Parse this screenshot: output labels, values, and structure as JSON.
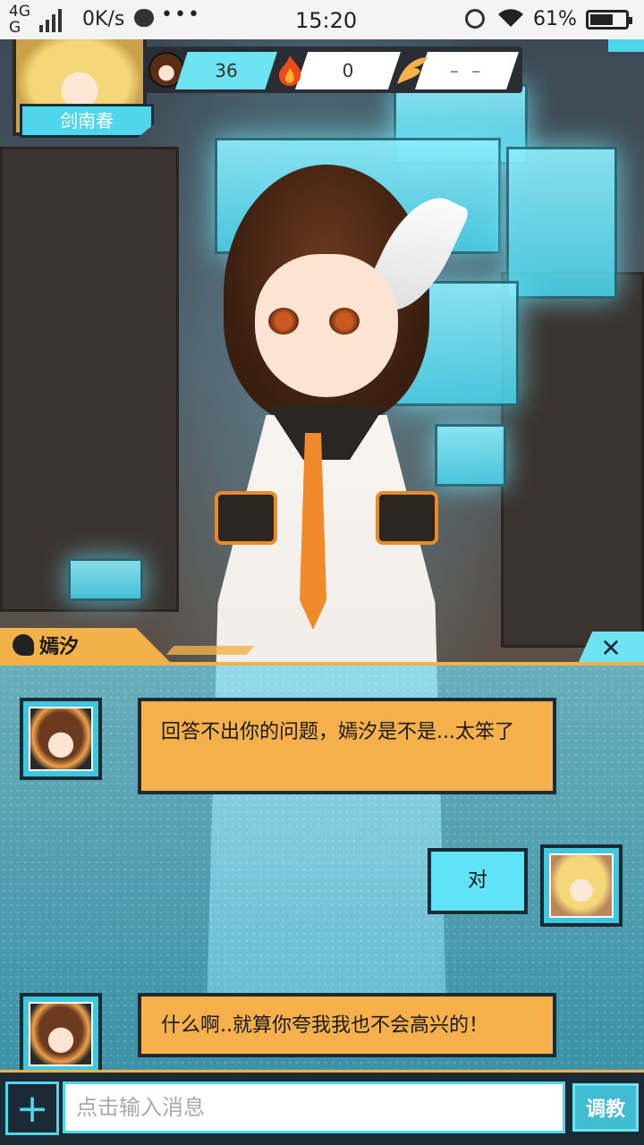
{
  "status_bar": {
    "network_top": "4G",
    "network_bottom": "G",
    "speed": "0K/s",
    "more": "•••",
    "time": "15:20",
    "battery": "61%"
  },
  "player": {
    "name": "剑南春"
  },
  "stats": {
    "level": "36",
    "fire": "0",
    "wing": "– –"
  },
  "speaker": {
    "name": "嫣汐",
    "close": "✕"
  },
  "messages": [
    {
      "from": "npc",
      "text": "回答不出你的问题，嫣汐是不是...太笨了"
    },
    {
      "from": "me",
      "text": "对"
    },
    {
      "from": "npc",
      "text": "什么啊..就算你夸我我也不会高兴的！"
    }
  ],
  "input": {
    "plus": "+",
    "placeholder": "点击输入消息",
    "teach_label": "调教"
  },
  "colors": {
    "accent_cyan": "#4fd6ea",
    "accent_orange": "#f2b24a",
    "frame_dark": "#1c2a36"
  }
}
